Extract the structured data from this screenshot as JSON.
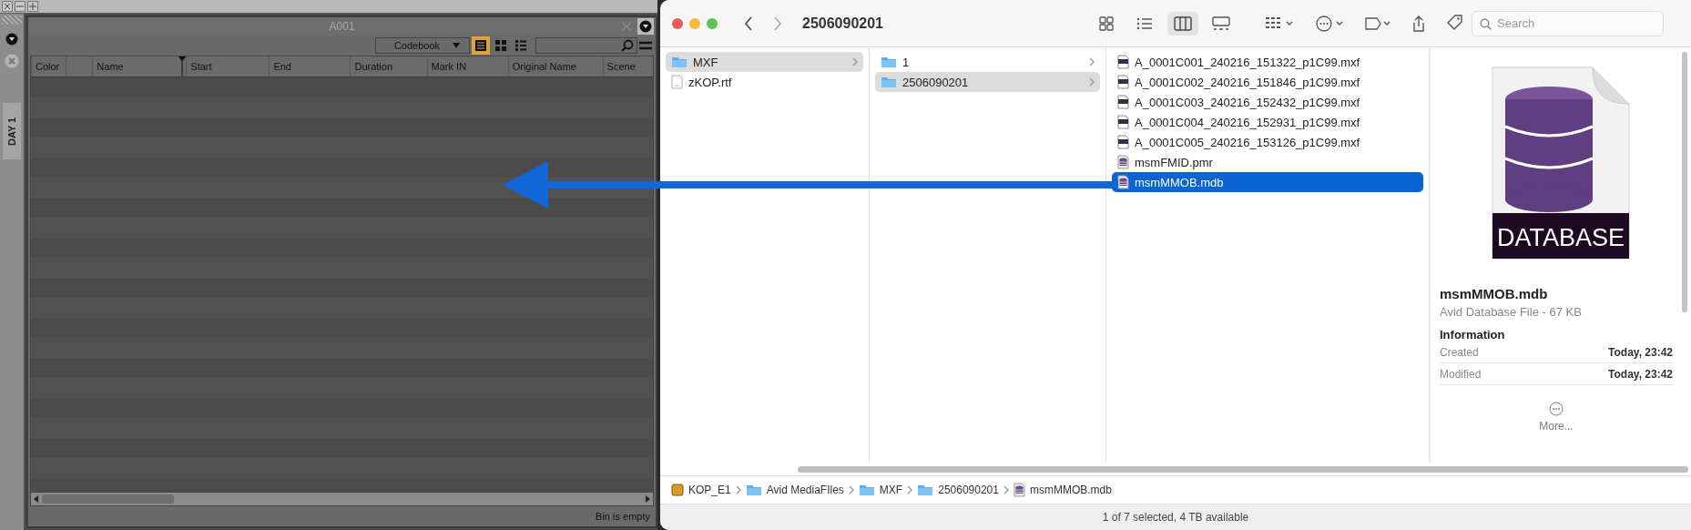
{
  "bin_window": {
    "title": "A001",
    "side_tab": "DAY 1",
    "view_menu": "Codebook",
    "view_modes": [
      {
        "kind": "frame",
        "selected": true
      },
      {
        "kind": "grid",
        "selected": false
      },
      {
        "kind": "script",
        "selected": false
      }
    ],
    "columns": [
      "Color",
      "Name",
      "Start",
      "End",
      "Duration",
      "Mark IN",
      "Original Name",
      "Scene"
    ],
    "status": "Bin is empty"
  },
  "finder": {
    "title": "2506090201",
    "search": {
      "placeholder": "Search"
    },
    "view_modes": [
      {
        "kind": "icons",
        "selected": false
      },
      {
        "kind": "list",
        "selected": false
      },
      {
        "kind": "columns",
        "selected": true
      },
      {
        "kind": "gallery",
        "selected": false
      }
    ],
    "columns": [
      {
        "active": false,
        "items": [
          {
            "name": "MXF",
            "kind": "folder",
            "selected": true
          },
          {
            "name": "zKOP.rtf",
            "kind": "document",
            "selected": false
          }
        ]
      },
      {
        "active": false,
        "items": [
          {
            "name": "1",
            "kind": "folder",
            "selected": false
          },
          {
            "name": "2506090201",
            "kind": "folder",
            "selected": true
          }
        ]
      },
      {
        "active": true,
        "items": [
          {
            "name": "A_0001C001_240216_151322_p1C99.mxf",
            "kind": "media",
            "selected": false
          },
          {
            "name": "A_0001C002_240216_151846_p1C99.mxf",
            "kind": "media",
            "selected": false
          },
          {
            "name": "A_0001C003_240216_152432_p1C99.mxf",
            "kind": "media",
            "selected": false
          },
          {
            "name": "A_0001C004_240216_152931_p1C99.mxf",
            "kind": "media",
            "selected": false
          },
          {
            "name": "A_0001C005_240216_153126_p1C99.mxf",
            "kind": "media",
            "selected": false
          },
          {
            "name": "msmFMID.pmr",
            "kind": "database",
            "selected": false
          },
          {
            "name": "msmMMOB.mdb",
            "kind": "database",
            "selected": true
          }
        ]
      }
    ],
    "preview": {
      "icon_label": "DATABASE",
      "name": "msmMMOB.mdb",
      "subtitle": "Avid Database File - 67 KB",
      "section": "Information",
      "info": [
        {
          "label": "Created",
          "value": "Today, 23:42"
        },
        {
          "label": "Modified",
          "value": "Today, 23:42"
        }
      ],
      "more": "More..."
    },
    "path": [
      {
        "name": "KOP_E1",
        "kind": "drive"
      },
      {
        "name": "Avid MediaFIles",
        "kind": "folder"
      },
      {
        "name": "MXF",
        "kind": "folder"
      },
      {
        "name": "2506090201",
        "kind": "folder"
      },
      {
        "name": "msmMMOB.mdb",
        "kind": "database"
      }
    ],
    "status": "1 of 7 selected, 4 TB available"
  }
}
